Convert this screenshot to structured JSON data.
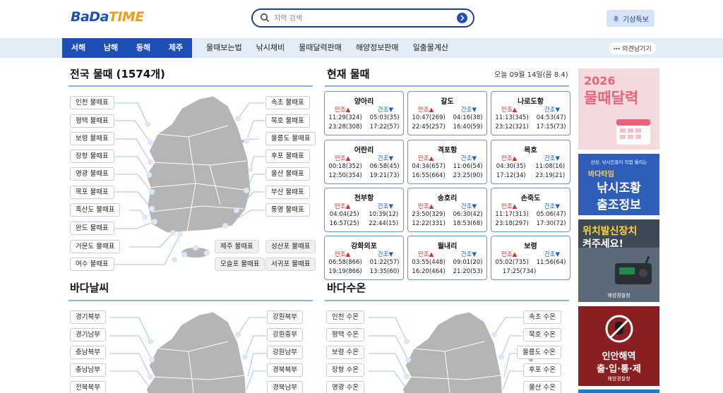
{
  "header": {
    "logo_part1": "BaDa",
    "logo_part2": "TIME",
    "search_placeholder": "지역 검색",
    "alert_button": "기상특보"
  },
  "nav": {
    "seas": [
      "서해",
      "남해",
      "동해",
      "제주"
    ],
    "links": [
      "물때보는법",
      "낚시채비",
      "물때달력판매",
      "해양정보판매",
      "일출물계산"
    ],
    "feedback": "의견남기기"
  },
  "tide_map": {
    "title": "전국 물때 (1574개)",
    "left_labels": [
      "인천 물때표",
      "평택 물때표",
      "보령 물때표",
      "장항 물때표",
      "영광 물때표",
      "목포 물때표",
      "흑산도 물때표",
      "완도 물때표",
      "거문도 물때표",
      "여수 물때표"
    ],
    "right_labels": [
      "속초 물때표",
      "묵호 물때표",
      "울릉도 물때표",
      "후포 물때표",
      "울산 물때표",
      "부산 물때표",
      "통영 물때표"
    ],
    "jeju_labels": [
      "제주 물때표",
      "성산포 물때표",
      "모슬포 물때표",
      "서귀포 물때표"
    ]
  },
  "current_tide": {
    "title": "현재 물때",
    "today": "오늘 09월 14일(음 8.4)",
    "high_label": "만조▲",
    "low_label": "간조▼",
    "stations": [
      {
        "name": "양아리",
        "row1": [
          "11:29(324)",
          "05:03(35)"
        ],
        "row2": [
          "23:28(308)",
          "17:22(57)"
        ]
      },
      {
        "name": "갈도",
        "row1": [
          "10:47(269)",
          "04:16(38)"
        ],
        "row2": [
          "22:45(257)",
          "16:40(59)"
        ]
      },
      {
        "name": "나로도항",
        "row1": [
          "11:13(345)",
          "04:53(47)"
        ],
        "row2": [
          "23:12(321)",
          "17:15(73)"
        ]
      },
      {
        "name": "어란리",
        "row1": [
          "00:18(352)",
          "06:58(45)"
        ],
        "row2": [
          "12:50(354)",
          "19:21(73)"
        ]
      },
      {
        "name": "격포항",
        "row1": [
          "04:34(657)",
          "11:06(54)"
        ],
        "row2": [
          "16:55(664)",
          "23:25(90)"
        ]
      },
      {
        "name": "목호",
        "row1": [
          "04:30(35)",
          "11:08(16)"
        ],
        "row2": [
          "17:12(34)",
          "23:19(21)"
        ]
      },
      {
        "name": "천부항",
        "row1": [
          "04:04(25)",
          "10:39(12)"
        ],
        "row2": [
          "16:57(25)",
          "22:44(15)"
        ]
      },
      {
        "name": "송호리",
        "row1": [
          "23:50(329)",
          "06:30(42)"
        ],
        "row2": [
          "12:22(331)",
          "18:53(68)"
        ]
      },
      {
        "name": "손죽도",
        "row1": [
          "11:17(313)",
          "05:06(47)"
        ],
        "row2": [
          "23:18(297)",
          "17:30(72)"
        ]
      },
      {
        "name": "강화외포",
        "row1": [
          "06:58(866)",
          "01:22(57)"
        ],
        "row2": [
          "19:19(866)",
          "13:35(60)"
        ]
      },
      {
        "name": "월내리",
        "row1": [
          "03:55(448)",
          "09:01(20)"
        ],
        "row2": [
          "16:20(464)",
          "21:20(53)"
        ]
      },
      {
        "name": "보령",
        "row1": [
          "05:02(735)",
          "11:56(64)"
        ],
        "row2": [
          "17:25(734)",
          ""
        ]
      }
    ]
  },
  "sea_weather": {
    "title": "바다날씨",
    "left_labels": [
      "경기북부",
      "경기남부",
      "충남북부",
      "충남남부",
      "전북북부"
    ],
    "right_labels": [
      "강원북부",
      "강원중부",
      "강원남부",
      "경북북부",
      "경북남부"
    ]
  },
  "water_temp": {
    "title": "바다수온",
    "left_labels": [
      "인천 수온",
      "평택 수온",
      "보령 수온",
      "장항 수온",
      "영광 수온"
    ],
    "right_labels": [
      "속초 수온",
      "묵호 수온",
      "울릉도 수온",
      "후포 수온",
      "울산 수온"
    ]
  },
  "ads": {
    "ad1_title": "2026",
    "ad1_sub": "물때달력",
    "ad2_top": "선상, 낚시인들이 직접 올리는",
    "ad2_brand": "바다타임",
    "ad2_main1": "낚시조황",
    "ad2_main2": "출조정보",
    "ad3_title1": "위치발신장치",
    "ad3_title2": "켜주세요!",
    "ad3_footer": "해양경찰청",
    "ad4_title1": "인안해역",
    "ad4_title2": "출·입·통·제",
    "ad4_footer": "해양경찰청"
  },
  "colors": {
    "brand_blue": "#1e4fb4",
    "brand_orange": "#f29a1c",
    "high_tide_red": "#d52b2b",
    "low_tide_blue": "#1f5fc4"
  }
}
